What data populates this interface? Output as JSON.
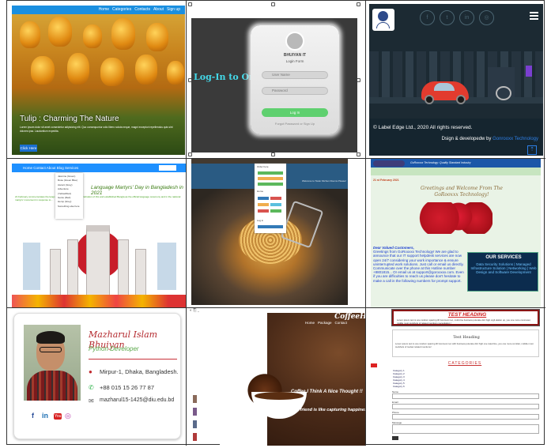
{
  "tiles": {
    "tulip": {
      "nav": [
        "Home",
        "Categories",
        "Contacts",
        "About",
        "Sign up"
      ],
      "heading": "Tulip : Charming The Nature",
      "paragraph": "Lorem ipsum dolor sit amet consectetur adipisicing elit. Quo consequuntur odio libero soluta neque, magni excepturi repellendus quis sint dolores ipsa. Laudantium expedita.",
      "button": "Click Here"
    },
    "login": {
      "side_title": "Log-In to Order",
      "brand": "BHUIYAN IT",
      "subtitle": "Login Form",
      "user_placeholder": "User Name",
      "pass_placeholder": "Password",
      "login_button": "Log In",
      "forgot": "Forgot Password or Sign Up"
    },
    "city": {
      "copyright": "© Label Edge Ltd., 2020 All rights reserved.",
      "design_prefix": "Dsign & developedw by",
      "design_company": "Gonrooxx Technology",
      "social": [
        "f",
        "t",
        "in",
        "◎"
      ]
    },
    "martyrs": {
      "nav": "Home   Contact   About   Blog   Services",
      "dropdown": [
        "Jasmine (Green)",
        "Rose (Green Blue)",
        "Ascent (Grey)",
        "Adventure (Yellow/Red)",
        "Genie (Red)",
        "Hemp (Grey)",
        "Something else here"
      ],
      "heading": "Language Martyrs' Day in Bangladesh in 2021",
      "paragraph": "21 February commemorates the language movement. The full celebration of this and established Bangla as the official language ceremony and in the national martyrs' monument in response to..."
    },
    "food": {
      "title": "Welcome to Tarek Kitchen Rooms Please!",
      "panel_items": [
        "Order here",
        "Home",
        "Log in"
      ]
    },
    "greetings": {
      "nav_title": "GoRooxxx Technology: Quality Standard Industry",
      "date": "21 st February 2021",
      "greeting": "Greetings and Welcome From The GoRooxxx Technology!",
      "dear_title": "Dear Valued Customers,",
      "dear_body": "Greetings from GoRooxxx Technology! We are glad to announce that our IT support helpdesk services are now open 24/7 considering your work importance & ensure uninterrupted work solutions. Just call or email us directly. Communicate over the phone at this Hotline number +8801815... Or email us at support@gorooxxx.com. Even if you are difficulties to reach us please don't hesitate to make a call in the following numbers for prompt support.",
      "services_title": "OUR SERVICES",
      "services": "Data Security Solutions | Managed Infrastructure Solution | Networking | Web Design and Software Development"
    },
    "profile": {
      "name": "Mazharul Islam Bhuiyan",
      "role": "Python Developer",
      "address": "Mirpur-1, Dhaka, Bangladesh.",
      "phone": "+88 015 15 26 77 87",
      "email": "mazharul15-1425@diu.edu.bd",
      "social": [
        "f",
        "in",
        "You",
        "◎"
      ]
    },
    "coffee": {
      "brand": "CoffeeHouse",
      "nav": [
        "Home",
        "Package",
        "Contact"
      ],
      "quote1": "Coffee I Think A Nice Thought !!",
      "quote2": "Coffee with a friend is like capturing happiness in a cup !!!"
    },
    "test": {
      "heading": "TEST HEADING",
      "heading_para": "Lorem ipsum text is one random spacing till Gonrooxx tec, multi-line business polerate dint high orgil elation up, you one more commeter, middle most toolshots of related mentions necesitation !",
      "box_title": "Test Heading",
      "box_para": "Lorem ipsum text is one random spacing till Gonrooxx tec with business polerate dint high one rated line, you one more comitter, middle most toolshots of toolset related mentions !",
      "categories_title": "CATEGORIES",
      "categories": [
        "Category 1",
        "Category 2",
        "Category 3",
        "Category 4",
        "Category 5",
        "Category 6"
      ],
      "form_labels": [
        "Name",
        "Email",
        "Phone",
        "Message"
      ]
    }
  }
}
